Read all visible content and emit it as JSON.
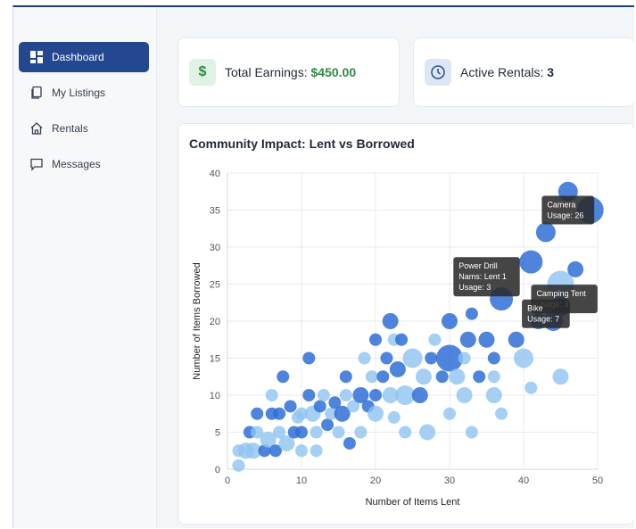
{
  "sidebar": {
    "items": [
      {
        "label": "Dashboard",
        "icon": "dashboard-icon",
        "active": true
      },
      {
        "label": "My Listings",
        "icon": "listings-icon",
        "active": false
      },
      {
        "label": "Rentals",
        "icon": "home-icon",
        "active": false
      },
      {
        "label": "Messages",
        "icon": "message-icon",
        "active": false
      }
    ]
  },
  "stats": {
    "earnings": {
      "label": "Total Earnings:",
      "value": "$450.00",
      "icon": "dollar-icon"
    },
    "rentals": {
      "label": "Active Rentals:",
      "value": "3",
      "icon": "clock-icon"
    }
  },
  "colors": {
    "brand": "#24488f",
    "green": "#2f8a49",
    "bubble_dark": "#2f6fd6",
    "bubble_light": "#8ec3f0"
  },
  "chart_data": {
    "type": "scatter",
    "title": "Community Impact: Lent vs Borrowed",
    "xlabel": "Number of Items Lent",
    "ylabel": "Number of Items Borrowed",
    "xlim": [
      0,
      50
    ],
    "ylim": [
      0,
      40
    ],
    "xticks": [
      0,
      10,
      20,
      30,
      40,
      50
    ],
    "yticks": [
      0,
      5,
      10,
      15,
      20,
      25,
      30,
      35,
      40
    ],
    "grid": true,
    "points": [
      {
        "x": 1.5,
        "y": 0.5,
        "size": 2,
        "shade": "light"
      },
      {
        "x": 1.5,
        "y": 2.5,
        "size": 2,
        "shade": "light"
      },
      {
        "x": 2.5,
        "y": 2.5,
        "size": 3,
        "shade": "light"
      },
      {
        "x": 3.5,
        "y": 2.5,
        "size": 3,
        "shade": "light"
      },
      {
        "x": 3,
        "y": 5,
        "size": 2,
        "shade": "dark"
      },
      {
        "x": 4,
        "y": 5,
        "size": 2,
        "shade": "light"
      },
      {
        "x": 4,
        "y": 7.5,
        "size": 2,
        "shade": "dark"
      },
      {
        "x": 5,
        "y": 2.5,
        "size": 2,
        "shade": "dark"
      },
      {
        "x": 5.5,
        "y": 4,
        "size": 3,
        "shade": "light"
      },
      {
        "x": 6,
        "y": 7.5,
        "size": 2,
        "shade": "dark"
      },
      {
        "x": 6,
        "y": 10,
        "size": 2,
        "shade": "light"
      },
      {
        "x": 6.5,
        "y": 2.5,
        "size": 2,
        "shade": "dark"
      },
      {
        "x": 7,
        "y": 5,
        "size": 2,
        "shade": "light"
      },
      {
        "x": 7,
        "y": 7.5,
        "size": 2,
        "shade": "dark"
      },
      {
        "x": 7.5,
        "y": 12.5,
        "size": 2,
        "shade": "dark"
      },
      {
        "x": 8,
        "y": 3.5,
        "size": 3,
        "shade": "light"
      },
      {
        "x": 8.5,
        "y": 8.5,
        "size": 2,
        "shade": "dark"
      },
      {
        "x": 9,
        "y": 5,
        "size": 2,
        "shade": "dark"
      },
      {
        "x": 9.5,
        "y": 7,
        "size": 2,
        "shade": "light"
      },
      {
        "x": 10,
        "y": 2.5,
        "size": 2,
        "shade": "light"
      },
      {
        "x": 10,
        "y": 5,
        "size": 2,
        "shade": "dark"
      },
      {
        "x": 10,
        "y": 7.5,
        "size": 2,
        "shade": "light"
      },
      {
        "x": 11,
        "y": 10,
        "size": 2,
        "shade": "dark"
      },
      {
        "x": 11,
        "y": 15,
        "size": 2,
        "shade": "dark"
      },
      {
        "x": 11.5,
        "y": 7.5,
        "size": 3,
        "shade": "light"
      },
      {
        "x": 12,
        "y": 5,
        "size": 2,
        "shade": "light"
      },
      {
        "x": 12,
        "y": 2.5,
        "size": 2,
        "shade": "light"
      },
      {
        "x": 12.5,
        "y": 8.5,
        "size": 2,
        "shade": "dark"
      },
      {
        "x": 13,
        "y": 10,
        "size": 2,
        "shade": "light"
      },
      {
        "x": 13.5,
        "y": 6,
        "size": 2,
        "shade": "dark"
      },
      {
        "x": 14,
        "y": 7.5,
        "size": 2,
        "shade": "light"
      },
      {
        "x": 14.5,
        "y": 9,
        "size": 2,
        "shade": "dark"
      },
      {
        "x": 15,
        "y": 5,
        "size": 2,
        "shade": "light"
      },
      {
        "x": 15.5,
        "y": 7.5,
        "size": 3,
        "shade": "dark"
      },
      {
        "x": 16,
        "y": 10,
        "size": 2,
        "shade": "light"
      },
      {
        "x": 16,
        "y": 12.5,
        "size": 2,
        "shade": "dark"
      },
      {
        "x": 16.5,
        "y": 3.5,
        "size": 2,
        "shade": "dark"
      },
      {
        "x": 17,
        "y": 8.5,
        "size": 2,
        "shade": "light"
      },
      {
        "x": 18,
        "y": 10,
        "size": 3,
        "shade": "dark"
      },
      {
        "x": 18,
        "y": 5,
        "size": 2,
        "shade": "light"
      },
      {
        "x": 18.5,
        "y": 15,
        "size": 2,
        "shade": "light"
      },
      {
        "x": 19,
        "y": 8.5,
        "size": 2,
        "shade": "dark"
      },
      {
        "x": 19.5,
        "y": 12.5,
        "size": 2,
        "shade": "light"
      },
      {
        "x": 20,
        "y": 7.5,
        "size": 3,
        "shade": "light"
      },
      {
        "x": 20,
        "y": 10,
        "size": 2,
        "shade": "dark"
      },
      {
        "x": 20,
        "y": 17.5,
        "size": 2,
        "shade": "dark"
      },
      {
        "x": 21,
        "y": 12.5,
        "size": 2,
        "shade": "dark"
      },
      {
        "x": 21.5,
        "y": 15,
        "size": 2,
        "shade": "dark"
      },
      {
        "x": 22,
        "y": 10,
        "size": 3,
        "shade": "light"
      },
      {
        "x": 22,
        "y": 20,
        "size": 3,
        "shade": "dark"
      },
      {
        "x": 22.5,
        "y": 17.5,
        "size": 2,
        "shade": "light"
      },
      {
        "x": 22.5,
        "y": 7,
        "size": 2,
        "shade": "light"
      },
      {
        "x": 23,
        "y": 13.5,
        "size": 3,
        "shade": "dark"
      },
      {
        "x": 23.5,
        "y": 17.5,
        "size": 2,
        "shade": "dark"
      },
      {
        "x": 24,
        "y": 10,
        "size": 4,
        "shade": "light"
      },
      {
        "x": 24,
        "y": 5,
        "size": 2,
        "shade": "light"
      },
      {
        "x": 25,
        "y": 15,
        "size": 4,
        "shade": "light"
      },
      {
        "x": 26,
        "y": 10,
        "size": 3,
        "shade": "dark"
      },
      {
        "x": 26.5,
        "y": 12.5,
        "size": 3,
        "shade": "light"
      },
      {
        "x": 27,
        "y": 5,
        "size": 3,
        "shade": "light"
      },
      {
        "x": 27.5,
        "y": 15,
        "size": 2,
        "shade": "dark"
      },
      {
        "x": 28,
        "y": 17.5,
        "size": 2,
        "shade": "light"
      },
      {
        "x": 29,
        "y": 12.5,
        "size": 2,
        "shade": "dark"
      },
      {
        "x": 30,
        "y": 20,
        "size": 3,
        "shade": "dark"
      },
      {
        "x": 30,
        "y": 15,
        "size": 6,
        "shade": "dark"
      },
      {
        "x": 30,
        "y": 7.5,
        "size": 2,
        "shade": "light"
      },
      {
        "x": 31,
        "y": 12.5,
        "size": 3,
        "shade": "light"
      },
      {
        "x": 32,
        "y": 10,
        "size": 3,
        "shade": "light"
      },
      {
        "x": 32,
        "y": 15,
        "size": 2,
        "shade": "light"
      },
      {
        "x": 32.5,
        "y": 17.5,
        "size": 3,
        "shade": "dark"
      },
      {
        "x": 33,
        "y": 5,
        "size": 2,
        "shade": "light"
      },
      {
        "x": 33,
        "y": 21,
        "size": 2,
        "shade": "dark"
      },
      {
        "x": 34,
        "y": 12.5,
        "size": 2,
        "shade": "dark"
      },
      {
        "x": 35,
        "y": 17.5,
        "size": 3,
        "shade": "dark"
      },
      {
        "x": 36,
        "y": 10,
        "size": 3,
        "shade": "light"
      },
      {
        "x": 36,
        "y": 12.5,
        "size": 2,
        "shade": "light"
      },
      {
        "x": 36,
        "y": 15,
        "size": 2,
        "shade": "dark"
      },
      {
        "x": 37,
        "y": 23,
        "size": 5,
        "shade": "dark"
      },
      {
        "x": 37,
        "y": 7.5,
        "size": 2,
        "shade": "light"
      },
      {
        "x": 39,
        "y": 17.5,
        "size": 3,
        "shade": "dark"
      },
      {
        "x": 40,
        "y": 15,
        "size": 4,
        "shade": "light"
      },
      {
        "x": 41,
        "y": 11,
        "size": 2,
        "shade": "light"
      },
      {
        "x": 41,
        "y": 28,
        "size": 5,
        "shade": "dark"
      },
      {
        "x": 42,
        "y": 20,
        "size": 3,
        "shade": "dark"
      },
      {
        "x": 43,
        "y": 32,
        "size": 4,
        "shade": "dark"
      },
      {
        "x": 44,
        "y": 20,
        "size": 4,
        "shade": "dark"
      },
      {
        "x": 45,
        "y": 22,
        "size": 4,
        "shade": "dark"
      },
      {
        "x": 45,
        "y": 25,
        "size": 6,
        "shade": "light"
      },
      {
        "x": 45,
        "y": 12.5,
        "size": 3,
        "shade": "light"
      },
      {
        "x": 46,
        "y": 37.5,
        "size": 4,
        "shade": "dark"
      },
      {
        "x": 47,
        "y": 27,
        "size": 3,
        "shade": "dark"
      },
      {
        "x": 49,
        "y": 35,
        "size": 6,
        "shade": "dark"
      }
    ],
    "annotations": [
      {
        "lines": [
          "Power Drill",
          "Nams: Lent 1",
          "Usage: 3"
        ],
        "x": 35,
        "y": 26
      },
      {
        "lines": [
          "Camera",
          "Usage: 26"
        ],
        "x": 46,
        "y": 35
      },
      {
        "lines": [
          "Camping Tent",
          "Usage: 3"
        ],
        "x": 45.5,
        "y": 23
      },
      {
        "lines": [
          "Bike",
          "Usage: 7"
        ],
        "x": 43,
        "y": 21
      }
    ]
  }
}
